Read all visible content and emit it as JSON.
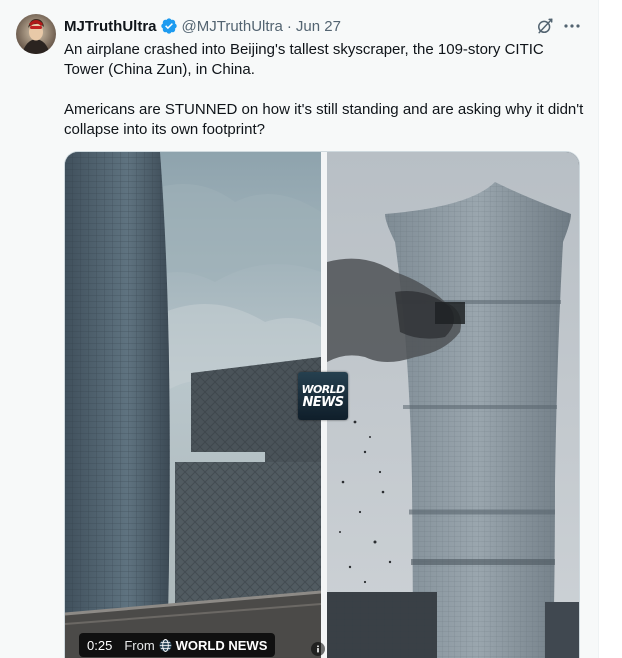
{
  "post": {
    "display_name": "MJTruthUltra",
    "handle": "@MJTruthUltra",
    "separator": "·",
    "date": "Jun 27",
    "text": "An airplane crashed into Beijing's tallest skyscraper, the 109-story CITIC Tower (China Zun), in China.\n\nAmericans are STUNNED on how it's still standing and are asking why it didn't collapse into its own footprint?"
  },
  "media": {
    "watermark": {
      "line1": "WORLD",
      "line2": "NEWS"
    },
    "duration": "0:25",
    "from_label": "From",
    "source": "WORLD NEWS"
  },
  "icons": {
    "verified": "verified-badge-icon",
    "grok": "grok-icon",
    "more": "more-icon",
    "info": "info-icon",
    "source_logo": "world-news-logo-icon"
  },
  "colors": {
    "verified_blue": "#1d9bf0",
    "text_primary": "#0f1419",
    "text_secondary": "#536471",
    "background": "#f7f9f9"
  }
}
